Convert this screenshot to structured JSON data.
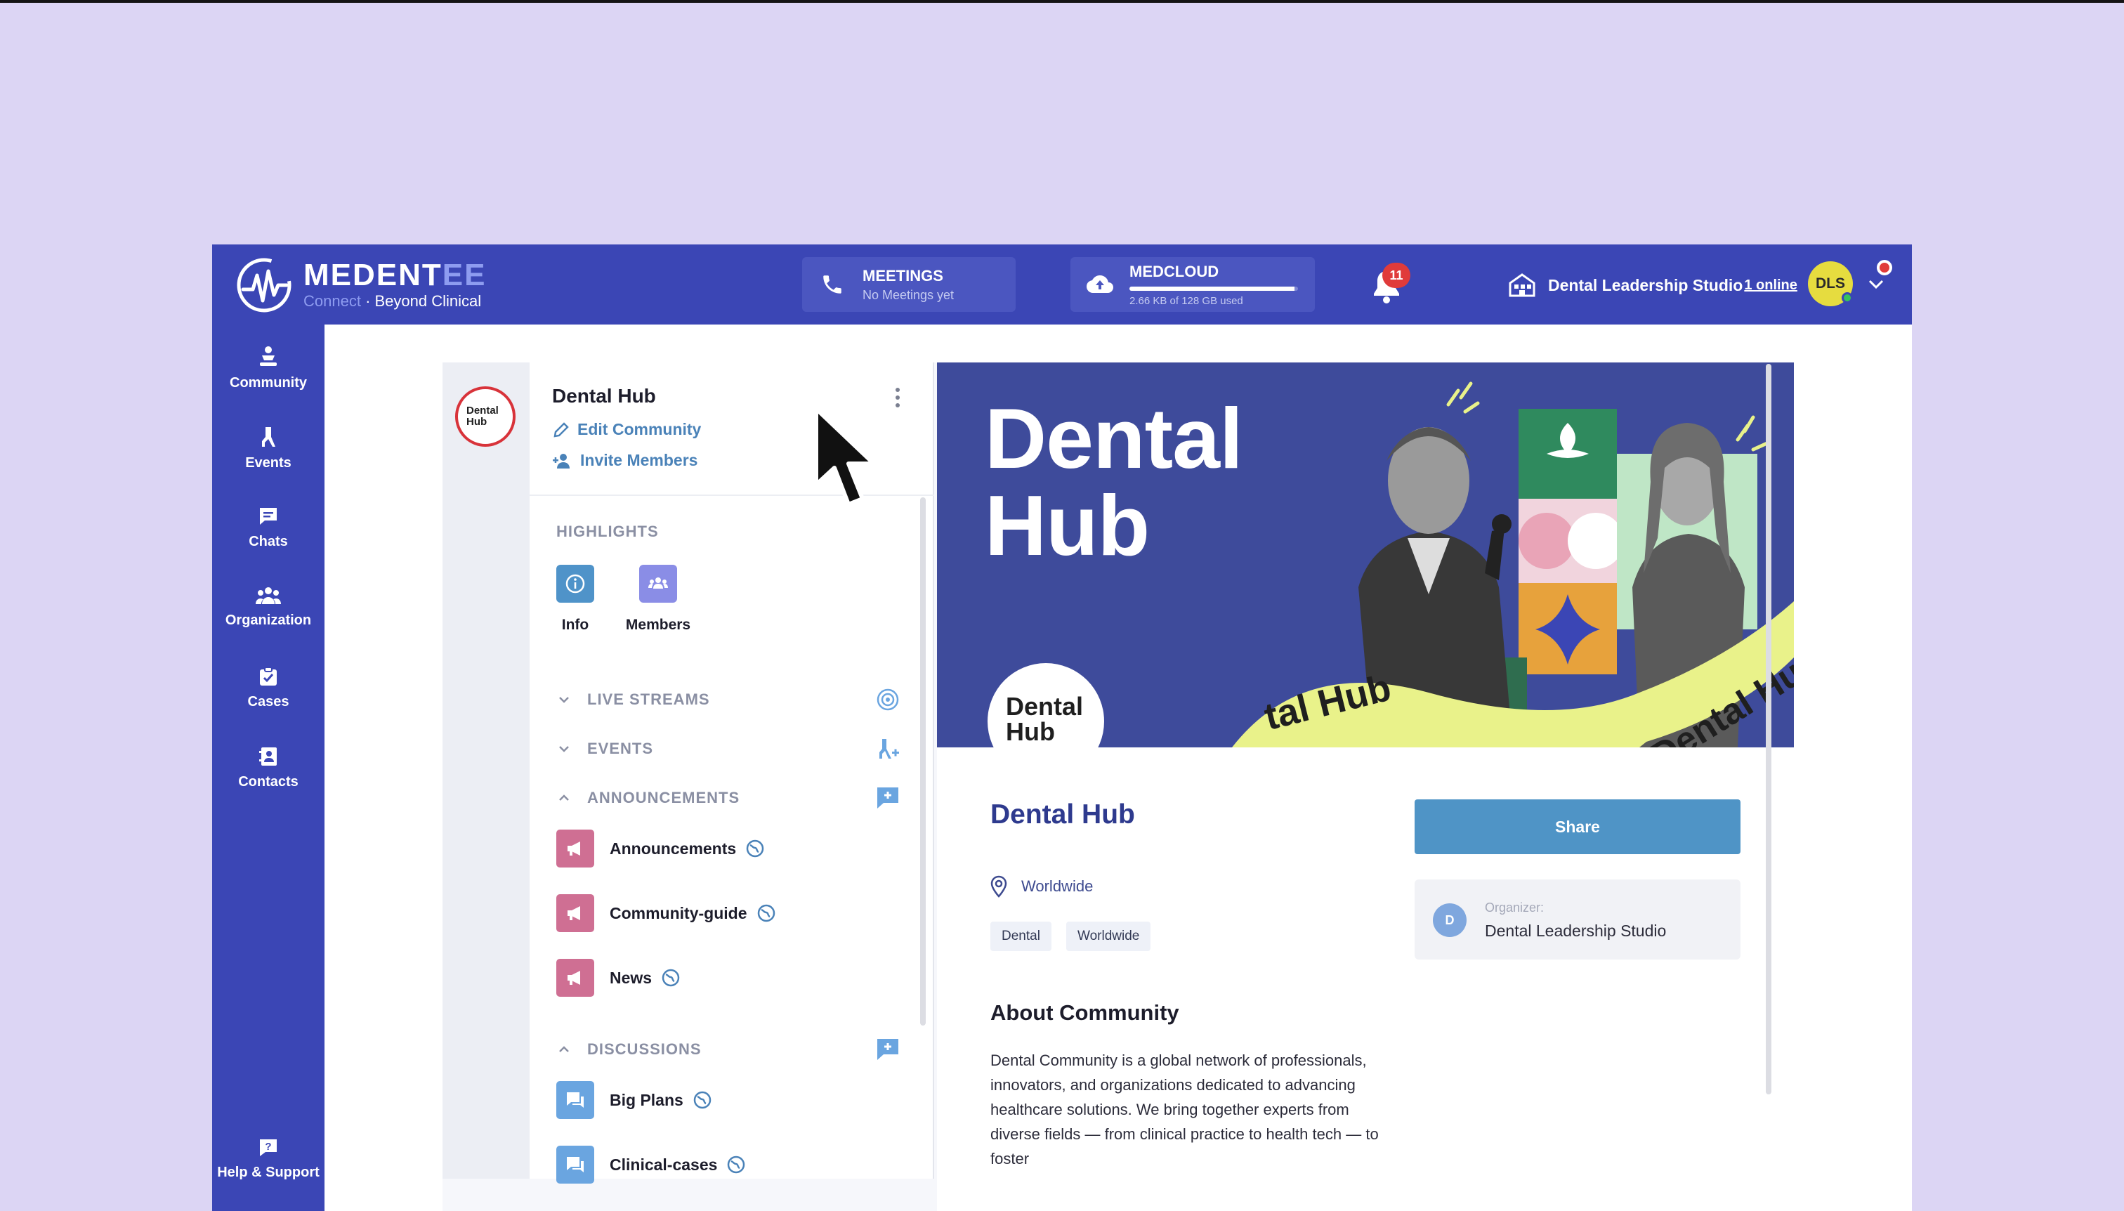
{
  "brand": {
    "name_main": "MEDENT",
    "name_accent": "EE",
    "tagline_dim": "Connect",
    "tagline": " · Beyond Clinical"
  },
  "header": {
    "meetings_title": "MEETINGS",
    "meetings_sub": "No Meetings yet",
    "medcloud_title": "MEDCLOUD",
    "medcloud_sub": "2.66 KB of 128 GB used",
    "medcloud_used_fraction": 0.0,
    "notification_count": "11",
    "org_name": "Dental Leadership Studio",
    "online_link": "1 online",
    "avatar_initials": "DLS"
  },
  "sidebar": {
    "items": [
      {
        "label": "Community",
        "icon": "community-icon"
      },
      {
        "label": "Events",
        "icon": "events-icon"
      },
      {
        "label": "Chats",
        "icon": "chat-icon"
      },
      {
        "label": "Organization",
        "icon": "organization-icon"
      },
      {
        "label": "Cases",
        "icon": "cases-icon"
      },
      {
        "label": "Contacts",
        "icon": "contacts-icon"
      }
    ],
    "help": "Help & Support"
  },
  "rail": {
    "logo_text": "Dental Hub"
  },
  "panel": {
    "title": "Dental Hub",
    "edit_link": "Edit Community",
    "invite_link": "Invite Members",
    "highlights_label": "HIGHLIGHTS",
    "highlights": [
      {
        "label": "Info",
        "icon": "info-icon"
      },
      {
        "label": "Members",
        "icon": "members-icon"
      }
    ],
    "groups": {
      "live_streams": "LIVE STREAMS",
      "events": "EVENTS",
      "announcements": "ANNOUNCEMENTS",
      "discussions": "DISCUSSIONS"
    },
    "announcement_channels": [
      "Announcements",
      "Community-guide",
      "News"
    ],
    "discussion_channels": [
      "Big Plans",
      "Clinical-cases"
    ]
  },
  "banner": {
    "title_line1": "Dental",
    "title_line2": "Hub",
    "badge_line1": "Dental",
    "badge_line2": "Hub",
    "ribbon_left": "tal Hub",
    "ribbon_right": "Dental Hub"
  },
  "community": {
    "title": "Dental Hub",
    "location": "Worldwide",
    "tags": [
      "Dental",
      "Worldwide"
    ],
    "share_label": "Share",
    "organizer_label": "Organizer:",
    "organizer_name": "Dental Leadership Studio",
    "organizer_initial": "D",
    "about_title": "About Community",
    "about_text": "Dental Community is a global network of professionals, innovators, and organizations dedicated to advancing healthcare solutions. We bring together experts from diverse fields — from clinical practice to health tech — to foster"
  },
  "colors": {
    "brand": "#3b46b5",
    "accent": "#8e9cf0",
    "share": "#4f94c6",
    "announcement_tile": "#cf6f93",
    "discussion_tile": "#6aa5e0",
    "banner_bg": "#3e4b9b",
    "ribbon": "#e9f28a"
  }
}
